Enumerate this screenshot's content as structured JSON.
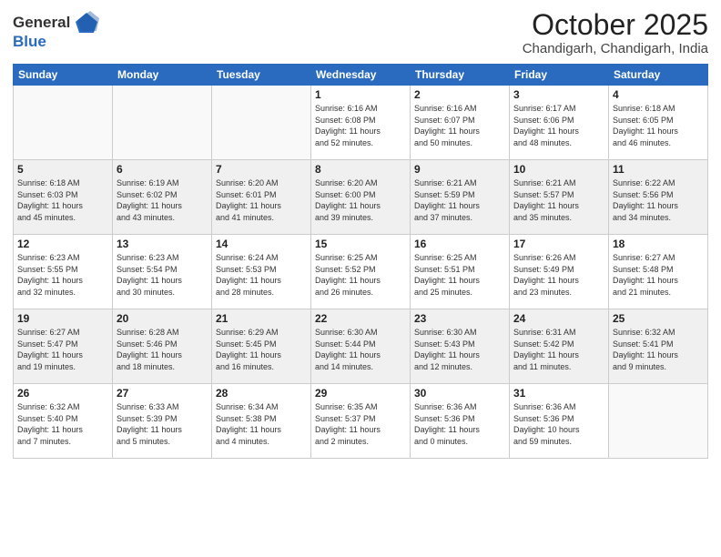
{
  "header": {
    "logo_line1": "General",
    "logo_line2": "Blue",
    "month_title": "October 2025",
    "location": "Chandigarh, Chandigarh, India"
  },
  "weekdays": [
    "Sunday",
    "Monday",
    "Tuesday",
    "Wednesday",
    "Thursday",
    "Friday",
    "Saturday"
  ],
  "weeks": [
    [
      {
        "day": "",
        "info": ""
      },
      {
        "day": "",
        "info": ""
      },
      {
        "day": "",
        "info": ""
      },
      {
        "day": "1",
        "info": "Sunrise: 6:16 AM\nSunset: 6:08 PM\nDaylight: 11 hours\nand 52 minutes."
      },
      {
        "day": "2",
        "info": "Sunrise: 6:16 AM\nSunset: 6:07 PM\nDaylight: 11 hours\nand 50 minutes."
      },
      {
        "day": "3",
        "info": "Sunrise: 6:17 AM\nSunset: 6:06 PM\nDaylight: 11 hours\nand 48 minutes."
      },
      {
        "day": "4",
        "info": "Sunrise: 6:18 AM\nSunset: 6:05 PM\nDaylight: 11 hours\nand 46 minutes."
      }
    ],
    [
      {
        "day": "5",
        "info": "Sunrise: 6:18 AM\nSunset: 6:03 PM\nDaylight: 11 hours\nand 45 minutes."
      },
      {
        "day": "6",
        "info": "Sunrise: 6:19 AM\nSunset: 6:02 PM\nDaylight: 11 hours\nand 43 minutes."
      },
      {
        "day": "7",
        "info": "Sunrise: 6:20 AM\nSunset: 6:01 PM\nDaylight: 11 hours\nand 41 minutes."
      },
      {
        "day": "8",
        "info": "Sunrise: 6:20 AM\nSunset: 6:00 PM\nDaylight: 11 hours\nand 39 minutes."
      },
      {
        "day": "9",
        "info": "Sunrise: 6:21 AM\nSunset: 5:59 PM\nDaylight: 11 hours\nand 37 minutes."
      },
      {
        "day": "10",
        "info": "Sunrise: 6:21 AM\nSunset: 5:57 PM\nDaylight: 11 hours\nand 35 minutes."
      },
      {
        "day": "11",
        "info": "Sunrise: 6:22 AM\nSunset: 5:56 PM\nDaylight: 11 hours\nand 34 minutes."
      }
    ],
    [
      {
        "day": "12",
        "info": "Sunrise: 6:23 AM\nSunset: 5:55 PM\nDaylight: 11 hours\nand 32 minutes."
      },
      {
        "day": "13",
        "info": "Sunrise: 6:23 AM\nSunset: 5:54 PM\nDaylight: 11 hours\nand 30 minutes."
      },
      {
        "day": "14",
        "info": "Sunrise: 6:24 AM\nSunset: 5:53 PM\nDaylight: 11 hours\nand 28 minutes."
      },
      {
        "day": "15",
        "info": "Sunrise: 6:25 AM\nSunset: 5:52 PM\nDaylight: 11 hours\nand 26 minutes."
      },
      {
        "day": "16",
        "info": "Sunrise: 6:25 AM\nSunset: 5:51 PM\nDaylight: 11 hours\nand 25 minutes."
      },
      {
        "day": "17",
        "info": "Sunrise: 6:26 AM\nSunset: 5:49 PM\nDaylight: 11 hours\nand 23 minutes."
      },
      {
        "day": "18",
        "info": "Sunrise: 6:27 AM\nSunset: 5:48 PM\nDaylight: 11 hours\nand 21 minutes."
      }
    ],
    [
      {
        "day": "19",
        "info": "Sunrise: 6:27 AM\nSunset: 5:47 PM\nDaylight: 11 hours\nand 19 minutes."
      },
      {
        "day": "20",
        "info": "Sunrise: 6:28 AM\nSunset: 5:46 PM\nDaylight: 11 hours\nand 18 minutes."
      },
      {
        "day": "21",
        "info": "Sunrise: 6:29 AM\nSunset: 5:45 PM\nDaylight: 11 hours\nand 16 minutes."
      },
      {
        "day": "22",
        "info": "Sunrise: 6:30 AM\nSunset: 5:44 PM\nDaylight: 11 hours\nand 14 minutes."
      },
      {
        "day": "23",
        "info": "Sunrise: 6:30 AM\nSunset: 5:43 PM\nDaylight: 11 hours\nand 12 minutes."
      },
      {
        "day": "24",
        "info": "Sunrise: 6:31 AM\nSunset: 5:42 PM\nDaylight: 11 hours\nand 11 minutes."
      },
      {
        "day": "25",
        "info": "Sunrise: 6:32 AM\nSunset: 5:41 PM\nDaylight: 11 hours\nand 9 minutes."
      }
    ],
    [
      {
        "day": "26",
        "info": "Sunrise: 6:32 AM\nSunset: 5:40 PM\nDaylight: 11 hours\nand 7 minutes."
      },
      {
        "day": "27",
        "info": "Sunrise: 6:33 AM\nSunset: 5:39 PM\nDaylight: 11 hours\nand 5 minutes."
      },
      {
        "day": "28",
        "info": "Sunrise: 6:34 AM\nSunset: 5:38 PM\nDaylight: 11 hours\nand 4 minutes."
      },
      {
        "day": "29",
        "info": "Sunrise: 6:35 AM\nSunset: 5:37 PM\nDaylight: 11 hours\nand 2 minutes."
      },
      {
        "day": "30",
        "info": "Sunrise: 6:36 AM\nSunset: 5:36 PM\nDaylight: 11 hours\nand 0 minutes."
      },
      {
        "day": "31",
        "info": "Sunrise: 6:36 AM\nSunset: 5:36 PM\nDaylight: 10 hours\nand 59 minutes."
      },
      {
        "day": "",
        "info": ""
      }
    ]
  ]
}
